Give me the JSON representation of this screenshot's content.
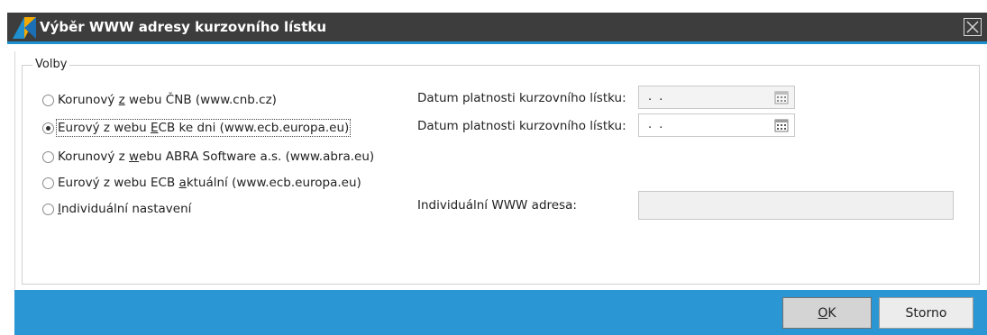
{
  "window": {
    "title": "Výběr WWW adresy kurzovního lístku"
  },
  "group": {
    "legend": "Volby"
  },
  "options": [
    {
      "pre": "Korunový ",
      "key": "z",
      "post": " webu ČNB (www.cnb.cz)",
      "checked": false
    },
    {
      "pre": "Eurový z webu ",
      "key": "E",
      "post": "CB ke dni (www.ecb.europa.eu)",
      "checked": true
    },
    {
      "pre": "Korunový z ",
      "key": "w",
      "post": "ebu ABRA Software a.s. (www.abra.eu)",
      "checked": false
    },
    {
      "pre": "Eurový z webu ECB ",
      "key": "a",
      "post": "ktuální (www.ecb.europa.eu)",
      "checked": false
    },
    {
      "pre": "",
      "key": "I",
      "post": "ndividuální nastavení",
      "checked": false
    }
  ],
  "fields": {
    "date1_label": "Datum platnosti kurzovního lístku:",
    "date1_value": ". .",
    "date2_label": "Datum platnosti kurzovního lístku:",
    "date2_value": ". .",
    "url_label": "Individuální WWW adresa:",
    "url_value": ""
  },
  "buttons": {
    "ok_key": "O",
    "ok_rest": "K",
    "cancel": "Storno"
  },
  "colors": {
    "title_bg": "#3d3d3d",
    "accent": "#1e90cf",
    "footer": "#2a97d4"
  }
}
